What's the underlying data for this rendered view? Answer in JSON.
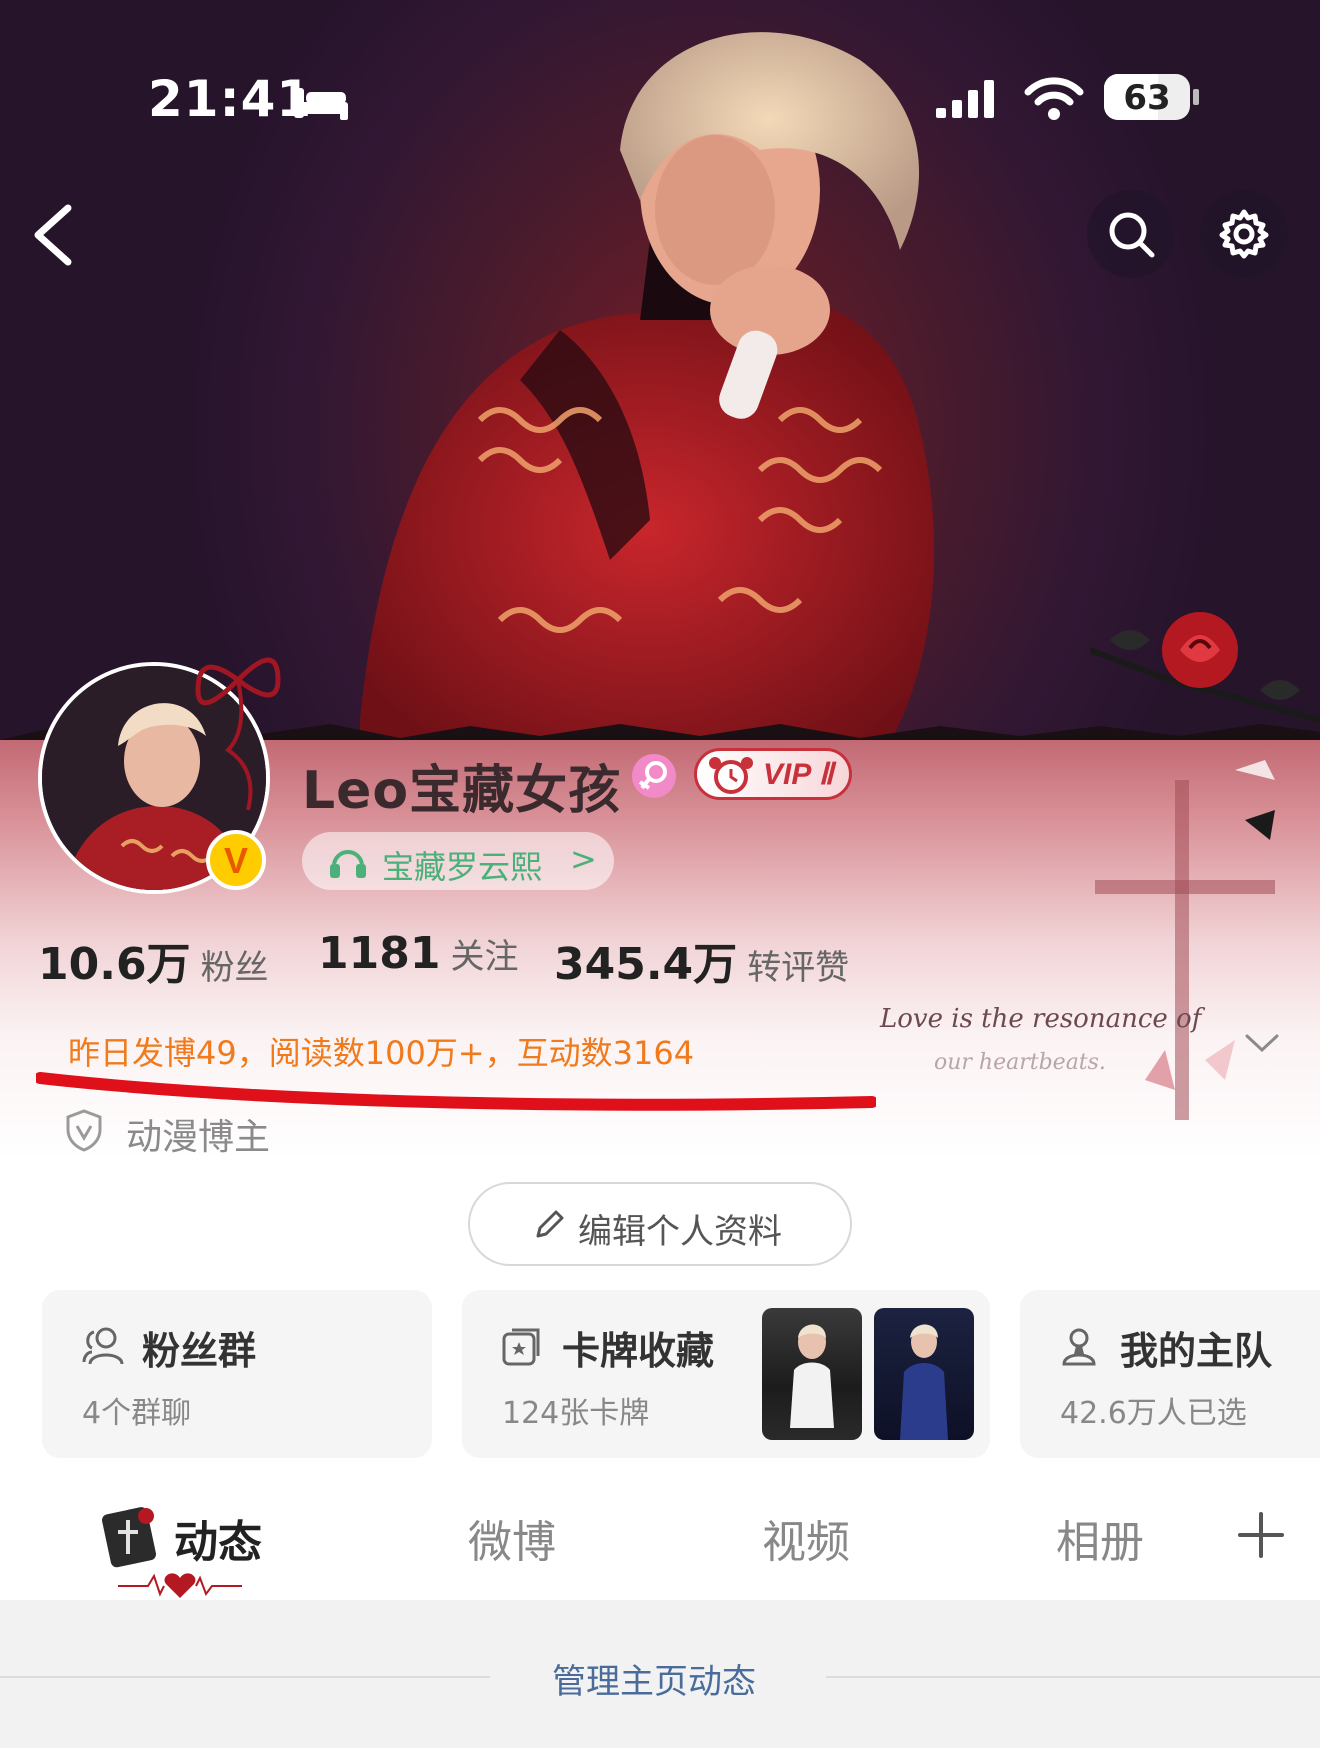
{
  "status_bar": {
    "time": "21:41",
    "battery": "63",
    "battery_level": 0.63
  },
  "profile": {
    "username": "Leo宝藏女孩",
    "vip_label": "VIP Ⅱ",
    "fan_tag": "宝藏罗云熙",
    "fan_tag_arrow": ">",
    "verified_mark": "V"
  },
  "stats": [
    {
      "value": "10.6万",
      "label": "粉丝"
    },
    {
      "value": "1181",
      "label": "关注"
    },
    {
      "value": "345.4万",
      "label": "转评赞"
    }
  ],
  "summary": "昨日发博49，阅读数100万+，互动数3164",
  "decor_text": {
    "line1": "Love is the resonance of",
    "line2": "our heartbeats."
  },
  "certification": "动漫博主",
  "edit_button": "编辑个人资料",
  "cards": {
    "fans": {
      "title": "粉丝群",
      "sub": "4个群聊"
    },
    "collection": {
      "title": "卡牌收藏",
      "sub": "124张卡牌"
    },
    "team": {
      "title": "我的主队",
      "sub": "42.6万人已选"
    }
  },
  "tabs": [
    "动态",
    "微博",
    "视频",
    "相册"
  ],
  "manage_link": "管理主页动态",
  "colors": {
    "summary": "#f07a1c",
    "underline": "#e0101a",
    "fan_tag": "#4bb07a",
    "link": "#4a6c9b"
  },
  "icons": [
    "bed-icon",
    "signal-icon",
    "wifi-icon",
    "back-icon",
    "search-icon",
    "gear-icon",
    "headphone-icon",
    "shield-icon",
    "pencil-icon",
    "people-icon",
    "card-icon",
    "team-icon",
    "chevron-down-icon",
    "plus-icon"
  ]
}
